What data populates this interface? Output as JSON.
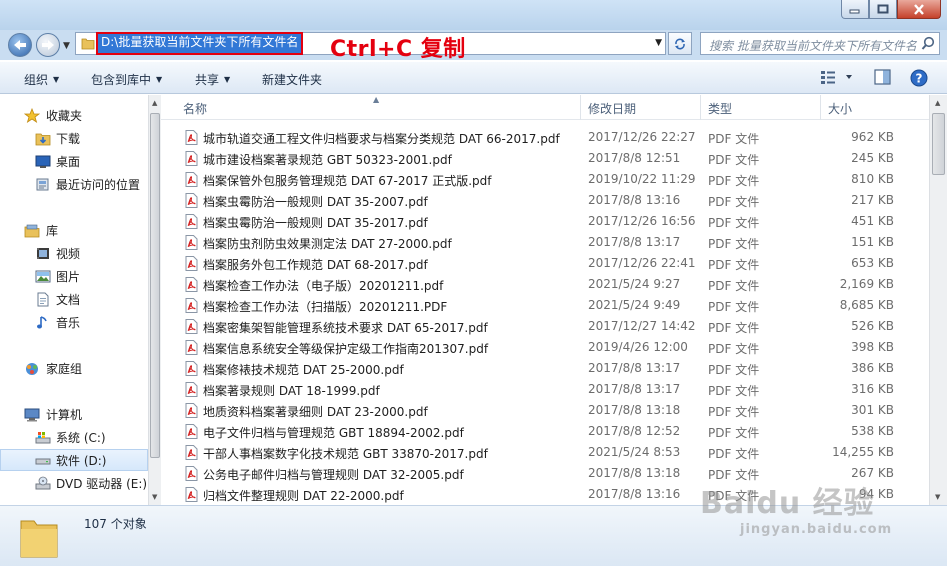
{
  "address": {
    "path": "D:\\批量获取当前文件夹下所有文件名",
    "annotation": "Ctrl+C 复制"
  },
  "search": {
    "placeholder": "搜索 批量获取当前文件夹下所有文件名"
  },
  "toolbar": {
    "organize": "组织",
    "include_in_library": "包含到库中",
    "share": "共享",
    "new_folder": "新建文件夹"
  },
  "nav": {
    "favorites": "收藏夹",
    "downloads": "下载",
    "desktop": "桌面",
    "recent": "最近访问的位置",
    "libraries": "库",
    "videos": "视频",
    "pictures": "图片",
    "documents": "文档",
    "music": "音乐",
    "homegroup": "家庭组",
    "computer": "计算机",
    "drive_c": "系统 (C:)",
    "drive_d": "软件 (D:)",
    "drive_e": "DVD 驱动器 (E:)"
  },
  "columns": {
    "name": "名称",
    "modified": "修改日期",
    "type": "类型",
    "size": "大小"
  },
  "files": [
    {
      "name": "城市轨道交通工程文件归档要求与档案分类规范 DAT 66-2017.pdf",
      "modified": "2017/12/26 22:27",
      "type": "PDF 文件",
      "size": "962 KB"
    },
    {
      "name": "城市建设档案著录规范 GBT 50323-2001.pdf",
      "modified": "2017/8/8 12:51",
      "type": "PDF 文件",
      "size": "245 KB"
    },
    {
      "name": "档案保管外包服务管理规范 DAT 67-2017 正式版.pdf",
      "modified": "2019/10/22 11:29",
      "type": "PDF 文件",
      "size": "810 KB"
    },
    {
      "name": "档案虫霉防治一般规则 DAT 35-2007.pdf",
      "modified": "2017/8/8 13:16",
      "type": "PDF 文件",
      "size": "217 KB"
    },
    {
      "name": "档案虫霉防治一般规则 DAT 35-2017.pdf",
      "modified": "2017/12/26 16:56",
      "type": "PDF 文件",
      "size": "451 KB"
    },
    {
      "name": "档案防虫剂防虫效果测定法 DAT 27-2000.pdf",
      "modified": "2017/8/8 13:17",
      "type": "PDF 文件",
      "size": "151 KB"
    },
    {
      "name": "档案服务外包工作规范 DAT 68-2017.pdf",
      "modified": "2017/12/26 22:41",
      "type": "PDF 文件",
      "size": "653 KB"
    },
    {
      "name": "档案检查工作办法（电子版）20201211.pdf",
      "modified": "2021/5/24 9:27",
      "type": "PDF 文件",
      "size": "2,169 KB"
    },
    {
      "name": "档案检查工作办法（扫描版）20201211.PDF",
      "modified": "2021/5/24 9:49",
      "type": "PDF 文件",
      "size": "8,685 KB"
    },
    {
      "name": "档案密集架智能管理系统技术要求 DAT 65-2017.pdf",
      "modified": "2017/12/27 14:42",
      "type": "PDF 文件",
      "size": "526 KB"
    },
    {
      "name": "档案信息系统安全等级保护定级工作指南201307.pdf",
      "modified": "2019/4/26 12:00",
      "type": "PDF 文件",
      "size": "398 KB"
    },
    {
      "name": "档案修裱技术规范 DAT 25-2000.pdf",
      "modified": "2017/8/8 13:17",
      "type": "PDF 文件",
      "size": "386 KB"
    },
    {
      "name": "档案著录规则 DAT 18-1999.pdf",
      "modified": "2017/8/8 13:17",
      "type": "PDF 文件",
      "size": "316 KB"
    },
    {
      "name": "地质资料档案著录细则 DAT 23-2000.pdf",
      "modified": "2017/8/8 13:18",
      "type": "PDF 文件",
      "size": "301 KB"
    },
    {
      "name": "电子文件归档与管理规范 GBT 18894-2002.pdf",
      "modified": "2017/8/8 12:52",
      "type": "PDF 文件",
      "size": "538 KB"
    },
    {
      "name": "干部人事档案数字化技术规范 GBT 33870-2017.pdf",
      "modified": "2021/5/24 8:53",
      "type": "PDF 文件",
      "size": "14,255 KB"
    },
    {
      "name": "公务电子邮件归档与管理规则 DAT 32-2005.pdf",
      "modified": "2017/8/8 13:18",
      "type": "PDF 文件",
      "size": "267 KB"
    },
    {
      "name": "归档文件整理规则 DAT 22-2000.pdf",
      "modified": "2017/8/8 13:16",
      "type": "PDF 文件",
      "size": "94 KB"
    }
  ],
  "details": {
    "count": "107 个对象"
  },
  "watermark": {
    "main": "Baidu 经验",
    "sub": "jingyan.baidu.com"
  }
}
